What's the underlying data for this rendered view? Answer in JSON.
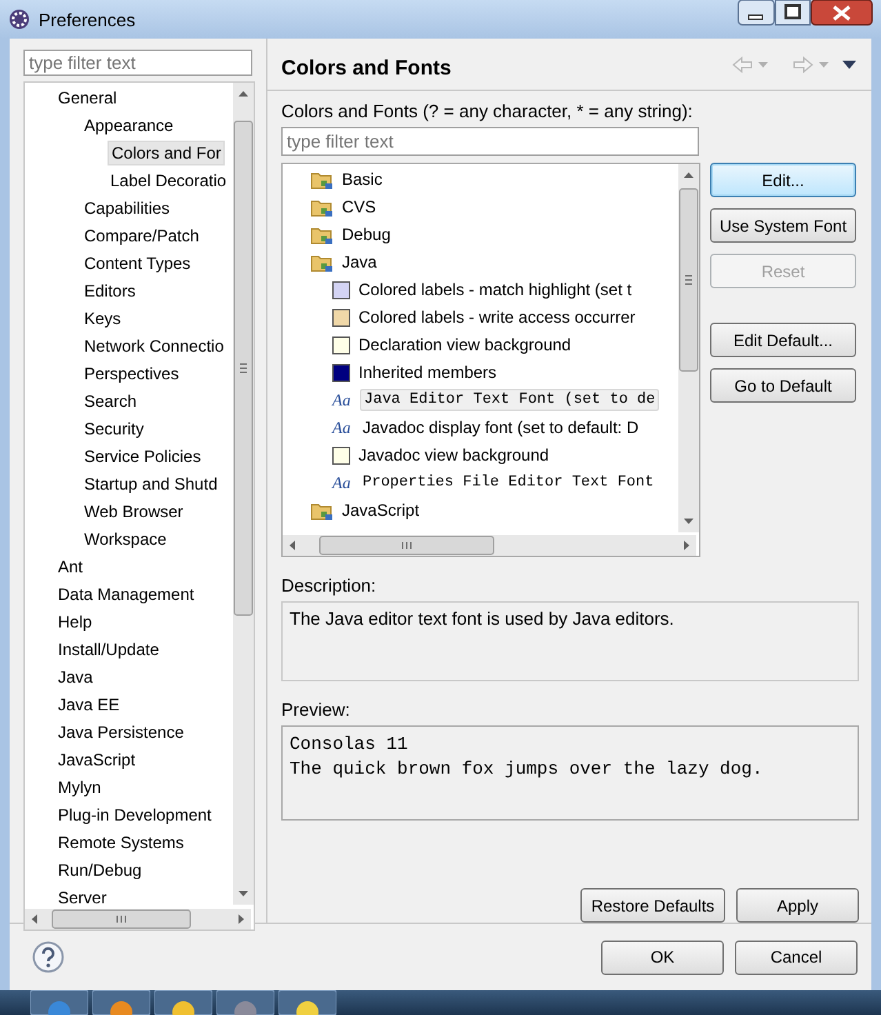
{
  "window": {
    "title": "Preferences"
  },
  "nav": {
    "filter_placeholder": "type filter text",
    "items": [
      {
        "label": "General",
        "selected": false,
        "children": [
          {
            "label": "Appearance",
            "selected": false,
            "children": [
              {
                "label": "Colors and For",
                "selected": true
              },
              {
                "label": "Label Decoratio",
                "selected": false
              }
            ]
          },
          {
            "label": "Capabilities",
            "selected": false
          },
          {
            "label": "Compare/Patch",
            "selected": false
          },
          {
            "label": "Content Types",
            "selected": false
          },
          {
            "label": "Editors",
            "selected": false
          },
          {
            "label": "Keys",
            "selected": false
          },
          {
            "label": "Network Connectio",
            "selected": false
          },
          {
            "label": "Perspectives",
            "selected": false
          },
          {
            "label": "Search",
            "selected": false
          },
          {
            "label": "Security",
            "selected": false
          },
          {
            "label": "Service Policies",
            "selected": false
          },
          {
            "label": "Startup and Shutd",
            "selected": false
          },
          {
            "label": "Web Browser",
            "selected": false
          },
          {
            "label": "Workspace",
            "selected": false
          }
        ]
      },
      {
        "label": "Ant",
        "selected": false
      },
      {
        "label": "Data Management",
        "selected": false
      },
      {
        "label": "Help",
        "selected": false
      },
      {
        "label": "Install/Update",
        "selected": false
      },
      {
        "label": "Java",
        "selected": false
      },
      {
        "label": "Java EE",
        "selected": false
      },
      {
        "label": "Java Persistence",
        "selected": false
      },
      {
        "label": "JavaScript",
        "selected": false
      },
      {
        "label": "Mylyn",
        "selected": false
      },
      {
        "label": "Plug-in Development",
        "selected": false
      },
      {
        "label": "Remote Systems",
        "selected": false
      },
      {
        "label": "Run/Debug",
        "selected": false
      },
      {
        "label": "Server",
        "selected": false
      }
    ]
  },
  "page": {
    "title": "Colors and Fonts",
    "filter_label": "Colors and Fonts (? = any character, * = any string):",
    "filter_placeholder": "type filter text",
    "tree": [
      {
        "label": "Basic",
        "kind": "category",
        "selected": false
      },
      {
        "label": "CVS",
        "kind": "category",
        "selected": false
      },
      {
        "label": "Debug",
        "kind": "category",
        "selected": false
      },
      {
        "label": "Java",
        "kind": "category",
        "selected": false,
        "children": [
          {
            "label": "Colored labels - match highlight (set t",
            "kind": "color",
            "color": "#d4d4f4",
            "selected": false
          },
          {
            "label": "Colored labels - write access occurrer",
            "kind": "color",
            "color": "#f0d8a8",
            "selected": false
          },
          {
            "label": "Declaration view background",
            "kind": "color",
            "color": "#ffffe8",
            "selected": false
          },
          {
            "label": "Inherited members",
            "kind": "color",
            "color": "#000080",
            "selected": false
          },
          {
            "label": "Java Editor Text Font (set to de",
            "kind": "font",
            "icon": "Aa",
            "mono": true,
            "selected": true
          },
          {
            "label": "Javadoc display font (set to default: D",
            "kind": "font",
            "icon": "Aa",
            "mono": false,
            "selected": false
          },
          {
            "label": "Javadoc view background",
            "kind": "color",
            "color": "#ffffe8",
            "selected": false
          },
          {
            "label": "Properties File Editor Text Font",
            "kind": "font",
            "icon": "Aa",
            "mono": true,
            "selected": false
          }
        ]
      },
      {
        "label": "JavaScript",
        "kind": "category",
        "selected": false
      }
    ],
    "buttons": [
      {
        "label": "Edit...",
        "focused": true,
        "disabled": false
      },
      {
        "label": "Use System Font",
        "focused": false,
        "disabled": false
      },
      {
        "label": "Reset",
        "focused": false,
        "disabled": true
      }
    ],
    "default_buttons": [
      {
        "label": "Edit Default...",
        "focused": false,
        "disabled": false
      },
      {
        "label": "Go to Default",
        "focused": false,
        "disabled": false
      }
    ],
    "description_label": "Description:",
    "description": "The Java editor text font is used by Java editors.",
    "preview_label": "Preview:",
    "preview_lines": [
      "Consolas 11",
      "The quick brown fox jumps over the lazy dog."
    ],
    "actions": [
      "Restore Defaults",
      "Apply"
    ]
  },
  "dialog_buttons": [
    "OK",
    "Cancel"
  ]
}
